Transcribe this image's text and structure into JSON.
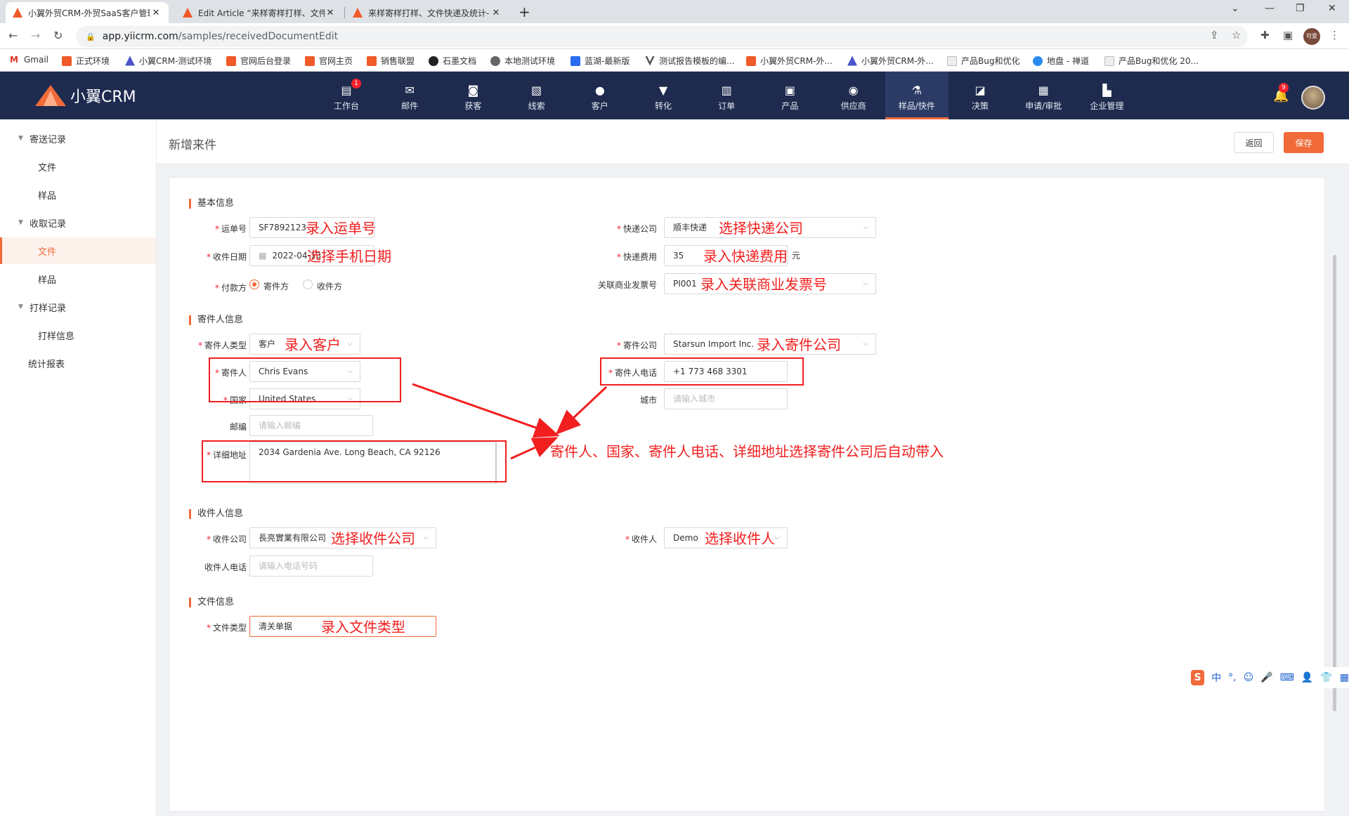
{
  "browser": {
    "tabs": [
      {
        "title": "小翼外贸CRM-外贸SaaS客户管理",
        "active": true
      },
      {
        "title": "Edit Article “来样寄样打样、文件",
        "active": false
      },
      {
        "title": "来样寄样打样、文件快递及统计-",
        "active": false
      }
    ],
    "url_host": "app.yiicrm.com",
    "url_path": "/samples/receivedDocumentEdit",
    "profile_label": "可爱",
    "bookmarks": [
      "Gmail",
      "正式环境",
      "小翼CRM-测试环境",
      "官网后台登录",
      "官网主页",
      "销售联盟",
      "石墨文档",
      "本地测试环境",
      "蓝湖-最新版",
      "测试报告模板的编...",
      "小翼外贸CRM-外...",
      "小翼外贸CRM-外...",
      "产品Bug和优化",
      "地盘 - 禅道",
      "产品Bug和优化 20..."
    ]
  },
  "app": {
    "logo_text": "小翼CRM",
    "nav": [
      {
        "label": "工作台",
        "icon": "dashboard-icon",
        "badge": "1"
      },
      {
        "label": "邮件",
        "icon": "mail-icon"
      },
      {
        "label": "获客",
        "icon": "acquire-icon"
      },
      {
        "label": "线索",
        "icon": "leads-icon"
      },
      {
        "label": "客户",
        "icon": "customer-icon"
      },
      {
        "label": "转化",
        "icon": "funnel-icon"
      },
      {
        "label": "订单",
        "icon": "order-icon"
      },
      {
        "label": "产品",
        "icon": "product-icon"
      },
      {
        "label": "供应商",
        "icon": "supplier-icon"
      },
      {
        "label": "样品/快件",
        "icon": "flask-icon",
        "active": true
      },
      {
        "label": "决策",
        "icon": "chart-icon"
      },
      {
        "label": "申请/审批",
        "icon": "approval-icon"
      },
      {
        "label": "企业管理",
        "icon": "building-icon"
      }
    ],
    "notification_count": "9"
  },
  "sidebar": {
    "items": [
      {
        "label": "寄送记录",
        "level": 0,
        "expanded": true
      },
      {
        "label": "文件",
        "level": 1
      },
      {
        "label": "样品",
        "level": 1
      },
      {
        "label": "收取记录",
        "level": 0,
        "expanded": true
      },
      {
        "label": "文件",
        "level": 1,
        "active": true
      },
      {
        "label": "样品",
        "level": 1
      },
      {
        "label": "打样记录",
        "level": 0,
        "expanded": true
      },
      {
        "label": "打样信息",
        "level": 1
      },
      {
        "label": "统计报表",
        "level": 0
      }
    ]
  },
  "page": {
    "title": "新增来件",
    "back_label": "返回",
    "save_label": "保存"
  },
  "form": {
    "sections": {
      "basic": "基本信息",
      "sender": "寄件人信息",
      "receiver": "收件人信息",
      "document": "文件信息"
    },
    "tracking_no": {
      "label": "运单号",
      "value": "SF7892123"
    },
    "courier": {
      "label": "快递公司",
      "value": "顺丰快递"
    },
    "receive_date": {
      "label": "收件日期",
      "value": "2022-04-13"
    },
    "courier_fee": {
      "label": "快递费用",
      "value": "35",
      "unit": "元"
    },
    "payer": {
      "label": "付款方",
      "options": [
        "寄件方",
        "收件方"
      ],
      "selected": "寄件方"
    },
    "invoice_no": {
      "label": "关联商业发票号",
      "value": "PI001"
    },
    "sender_type": {
      "label": "寄件人类型",
      "value": "客户"
    },
    "sender_company": {
      "label": "寄件公司",
      "value": "Starsun Import Inc."
    },
    "sender": {
      "label": "寄件人",
      "value": "Chris Evans"
    },
    "sender_phone": {
      "label": "寄件人电话",
      "value": "+1 773 468 3301"
    },
    "country": {
      "label": "国家",
      "value": "United States"
    },
    "city": {
      "label": "城市",
      "placeholder": "请输入城市"
    },
    "zip": {
      "label": "邮编",
      "placeholder": "请输入邮编"
    },
    "address": {
      "label": "详细地址",
      "value": "2034 Gardenia Ave. Long Beach, CA 92126"
    },
    "receiver_company": {
      "label": "收件公司",
      "value": "長亮實業有限公司"
    },
    "receiver": {
      "label": "收件人",
      "value": "Demo"
    },
    "receiver_phone": {
      "label": "收件人电话",
      "placeholder": "请输入电话号码"
    },
    "doc_type": {
      "label": "文件类型",
      "value": "清关单据"
    }
  },
  "annotations": {
    "tracking_no": "录入运单号",
    "courier": "选择快递公司",
    "date": "选择手机日期",
    "fee": "录入快递费用",
    "invoice": "录入关联商业发票号",
    "sender_type": "录入客户",
    "sender_company": "录入寄件公司",
    "auto_fill": "寄件人、国家、寄件人电话、详细地址选择寄件公司后自动带入",
    "receiver_company": "选择收件公司",
    "receiver": "选择收件人",
    "doc_type": "录入文件类型"
  },
  "ime": {
    "mode": "中"
  },
  "colors": {
    "accent": "#f06a3a",
    "header": "#1e2b4f",
    "annotation": "#f11f1f"
  }
}
